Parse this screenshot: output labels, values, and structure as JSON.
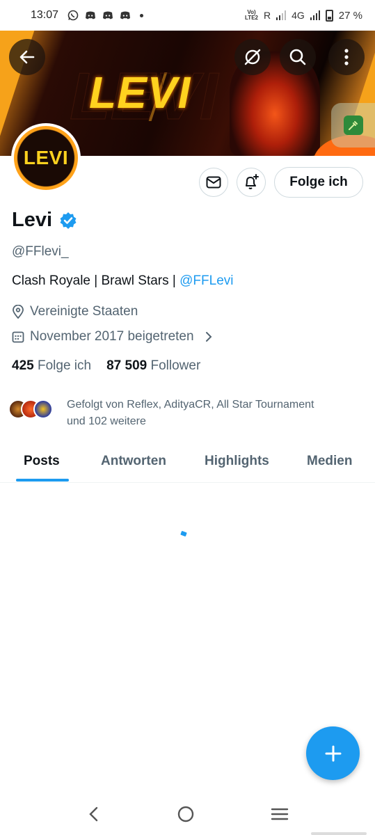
{
  "status_bar": {
    "time": "13:07",
    "notification_icons": [
      "whatsapp-icon",
      "discord-icon",
      "discord-icon",
      "discord-icon"
    ],
    "volte_label_top": "Vo)",
    "volte_label_bottom": "LTE2",
    "roaming": "R",
    "network": "4G",
    "battery_percent": "27 %"
  },
  "banner": {
    "text": "LEVI",
    "colors": {
      "accent": "#ffd21f",
      "orange": "#f6a21a"
    }
  },
  "header_actions": {
    "back_icon": "arrow-left-icon",
    "grok_icon": "grok-slash-circle-icon",
    "search_icon": "search-icon",
    "more_icon": "more-vertical-icon",
    "edit_icon": "eyedropper-icon"
  },
  "avatar": {
    "text": "LEVI"
  },
  "actions": {
    "message_icon": "mail-icon",
    "notify_icon": "bell-plus-icon",
    "follow_label": "Folge ich"
  },
  "profile": {
    "name": "Levi",
    "verified": true,
    "handle": "@FFlevi_",
    "bio_text": "Clash Royale | Brawl Stars | ",
    "bio_link": "@FFLevi",
    "location": "Vereinigte Staaten",
    "joined": "November 2017 beigetreten",
    "following_count": "425",
    "following_label": "Folge ich",
    "followers_count": "87 509",
    "followers_label": "Follower",
    "followed_by_line1": "Gefolgt von Reflex, AdityaCR, All Star Tournament",
    "followed_by_line2": "und 102 weitere"
  },
  "tabs": [
    {
      "label": "Posts",
      "active": true
    },
    {
      "label": "Antworten",
      "active": false
    },
    {
      "label": "Highlights",
      "active": false
    },
    {
      "label": "Medien",
      "active": false
    }
  ],
  "fab": {
    "icon": "plus-icon"
  },
  "nav_bar": {
    "icons": [
      "back-chevron-icon",
      "home-circle-icon",
      "recents-lines-icon"
    ]
  },
  "colors": {
    "primary": "#1d9bf0",
    "text": "#0f1419",
    "secondary_text": "#536471"
  }
}
